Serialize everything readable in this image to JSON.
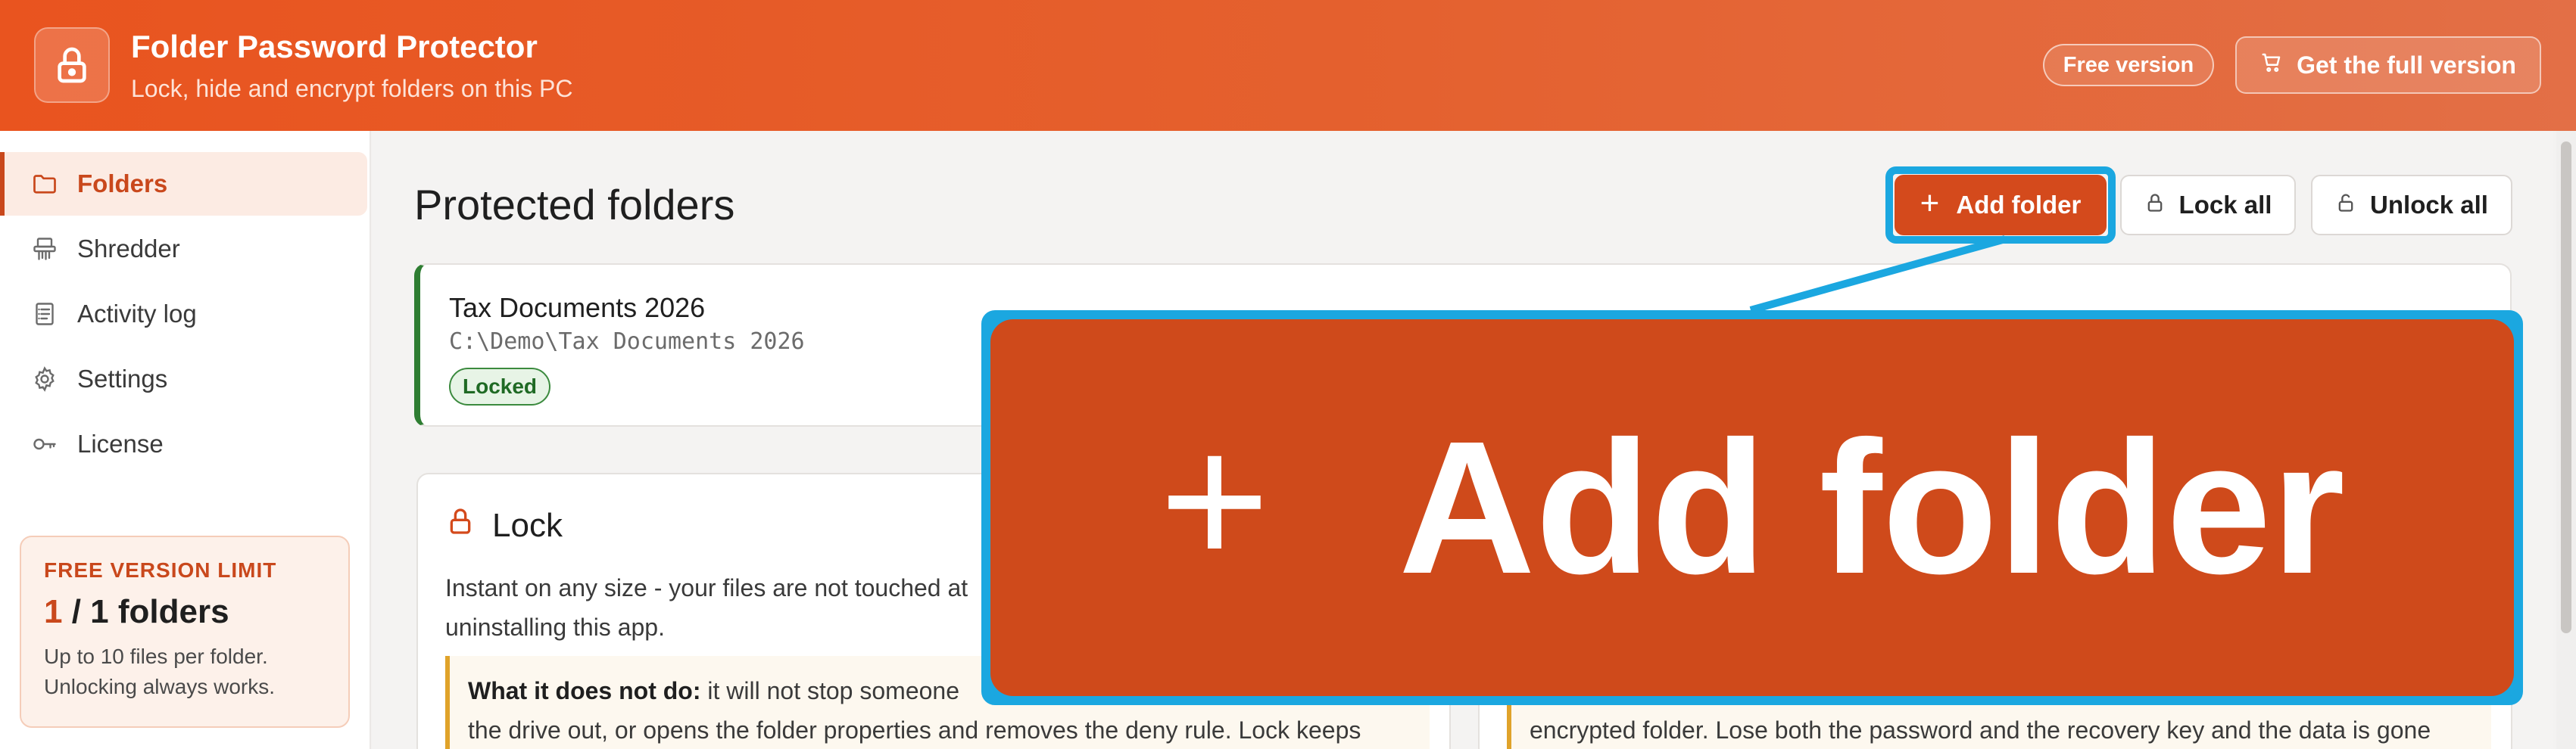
{
  "header": {
    "title": "Folder Password Protector",
    "subtitle": "Lock, hide and encrypt folders on this PC",
    "free_badge": "Free version",
    "get_full_label": "Get the full version"
  },
  "sidebar": {
    "items": [
      {
        "label": "Folders",
        "icon": "folder-icon",
        "active": true
      },
      {
        "label": "Shredder",
        "icon": "shredder-icon",
        "active": false
      },
      {
        "label": "Activity log",
        "icon": "log-icon",
        "active": false
      },
      {
        "label": "Settings",
        "icon": "gear-icon",
        "active": false
      },
      {
        "label": "License",
        "icon": "key-icon",
        "active": false
      }
    ],
    "limit": {
      "title": "FREE VERSION LIMIT",
      "used": "1",
      "separator": " / ",
      "total": "1 folders",
      "desc_line1": "Up to 10 files per folder.",
      "desc_line2": "Unlocking always works."
    }
  },
  "main": {
    "title": "Protected folders",
    "add_label": "Add folder",
    "lock_all_label": "Lock all",
    "unlock_all_label": "Unlock all",
    "folder": {
      "name": "Tax Documents 2026",
      "path": "C:\\Demo\\Tax Documents 2026",
      "status": "Locked"
    },
    "lock_card": {
      "title": "Lock",
      "desc_line1": "Instant on any size - your files are not touched at",
      "desc_line2": "uninstalling this app.",
      "note_bold": "What it does not do:",
      "note_line1": " it will not stop someone",
      "note_line2": "the drive out, or opens the folder properties and removes the deny rule. Lock keeps"
    },
    "encrypt_card": {
      "note_line2": "encrypted folder. Lose both the password and the recovery key and the data is gone"
    }
  },
  "zoom": {
    "label": "Add folder"
  },
  "colors": {
    "accent": "#d44a1c",
    "header": "#e9541f",
    "highlight": "#1ba7e0",
    "locked": "#2e7d32"
  }
}
